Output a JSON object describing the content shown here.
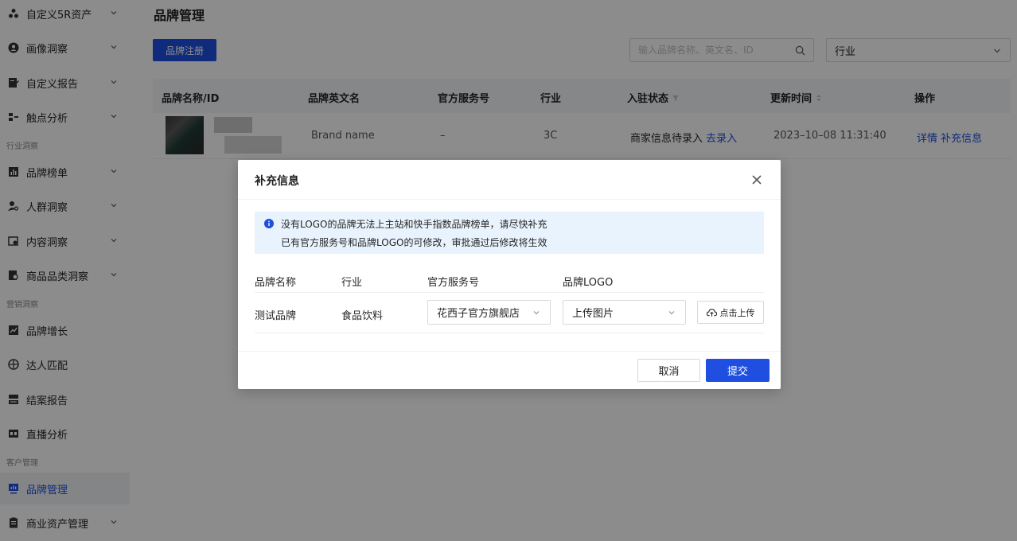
{
  "sidebar": {
    "items": [
      {
        "label": "自定义5R资产",
        "icon": "people-group-icon"
      },
      {
        "label": "画像洞察",
        "icon": "user-circle-icon"
      },
      {
        "label": "自定义报告",
        "icon": "report-edit-icon"
      },
      {
        "label": "触点分析",
        "icon": "touchpoint-icon"
      },
      {
        "label": "品牌榜单",
        "icon": "bar-chart-icon"
      },
      {
        "label": "人群洞察",
        "icon": "user-search-icon"
      },
      {
        "label": "内容洞察",
        "icon": "content-search-icon"
      },
      {
        "label": "商品品类洞察",
        "icon": "product-search-icon"
      },
      {
        "label": "品牌增长",
        "icon": "trend-icon"
      },
      {
        "label": "达人匹配",
        "icon": "match-icon"
      },
      {
        "label": "结案报告",
        "icon": "inbox-report-icon"
      },
      {
        "label": "直播分析",
        "icon": "live-icon"
      },
      {
        "label": "品牌管理",
        "icon": "brand-monitor-icon"
      },
      {
        "label": "商业资产管理",
        "icon": "clipboard-icon"
      }
    ],
    "groups": [
      "行业洞察",
      "营销洞察",
      "客户管理"
    ]
  },
  "main": {
    "title": "品牌管理",
    "register_button": "品牌注册",
    "search_placeholder": "输入品牌名称、英文名、ID",
    "industry_select": "行业",
    "table": {
      "headers": [
        "品牌名称/ID",
        "品牌英文名",
        "官方服务号",
        "行业",
        "入驻状态",
        "更新时间",
        "操作"
      ],
      "row": {
        "english_name": "Brand name",
        "service": "–",
        "industry": "3C",
        "status": "商家信息待录入",
        "status_link": "去录入",
        "updated": "2023–10–08 11:31:40",
        "action_detail": "详情",
        "action_supplement": "补充信息"
      }
    }
  },
  "modal": {
    "title": "补充信息",
    "alert_line1": "没有LOGO的品牌无法上主站和快手指数品牌榜单，请尽快补充",
    "alert_line2": "已有官方服务号和品牌LOGO的可修改，审批通过后修改将生效",
    "col_headers": [
      "品牌名称",
      "行业",
      "官方服务号",
      "品牌LOGO"
    ],
    "brand_name": "测试品牌",
    "industry": "食品饮料",
    "service_select": "花西子官方旗舰店",
    "logo_select": "上传图片",
    "upload_button": "点击上传",
    "cancel": "取消",
    "submit": "提交"
  },
  "colors": {
    "primary": "#1e4fe0",
    "alert_bg": "#e9f3fd"
  }
}
